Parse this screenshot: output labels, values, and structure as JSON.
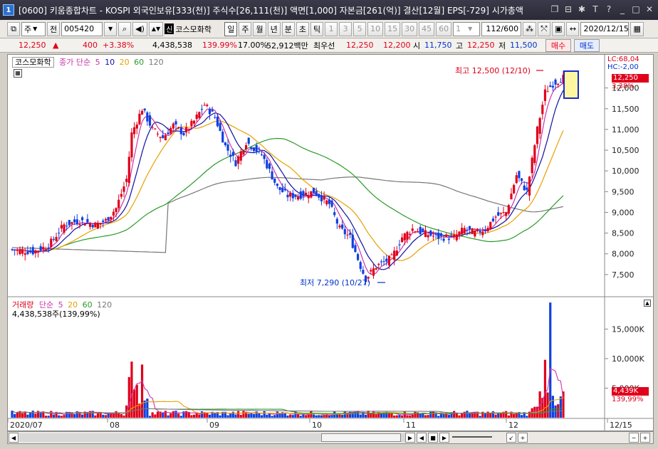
{
  "window": {
    "icon_label": "1",
    "title": "[0600] 키움종합차트 - KOSPI 외국인보유[333(천)] 주식수[26,111(천)] 액면[1,000] 자본금[261(억)] 결산[12월] EPS[-729] 시가총액"
  },
  "toolbar": {
    "type_select": "주",
    "jeon_btn": "전",
    "code": "005420",
    "company_badge": "신",
    "company": "코스모화학",
    "periods": [
      "일",
      "주",
      "월",
      "년",
      "분",
      "초",
      "틱"
    ],
    "active_period": "일",
    "intervals": [
      "1",
      "3",
      "5",
      "10",
      "15",
      "30",
      "45",
      "60"
    ],
    "interval_value": "1",
    "count": "112/600",
    "date": "2020/12/15"
  },
  "quote": {
    "price": "12,250",
    "arrow": "▲",
    "change": "400",
    "change_pct": "+3.38%",
    "volume": "4,438,538",
    "vol_ratio": "139.99%",
    "turnover": "17.00%",
    "amount": "52,912백만",
    "best_ask_label": "최우선",
    "best_ask": "12,250",
    "best_bid": "12,200",
    "open_label": "시",
    "open": "11,750",
    "high_label": "고",
    "high": "12,250",
    "low_label": "저",
    "low": "11,500",
    "buy_label": "매수",
    "sell_label": "매도"
  },
  "price_legend": {
    "name": "코스모화학",
    "ma_label": "종가 단순",
    "ma": [
      "5",
      "10",
      "20",
      "60",
      "120"
    ]
  },
  "volume_legend": {
    "label": "거래량",
    "ma_label": "단순",
    "ma": [
      "5",
      "20",
      "60",
      "120"
    ],
    "value": "4,438,538주(139,99%)"
  },
  "annotations": {
    "high": "최고 12,500 (12/10)",
    "low": "최저 7,290 (10/27)",
    "lc": "LC:68,04",
    "hc": "HC:-2,00",
    "cur_price": "12,250",
    "cur_pct": "3,38%",
    "vol_tag": "4,439K",
    "vol_pct": "139,99%"
  },
  "chart_data": {
    "type": "candlestick",
    "price_axis": [
      "12,000",
      "11,500",
      "11,000",
      "10,500",
      "10,000",
      "9,500",
      "9,000",
      "8,500",
      "8,000",
      "7,500"
    ],
    "volume_axis": [
      "15,000K",
      "10,000K",
      "5,000K"
    ],
    "x_labels": [
      "2020/07",
      "08",
      "09",
      "10",
      "11",
      "12",
      "12/15"
    ],
    "colors": {
      "up": "#e0001a",
      "down": "#1040e0",
      "ma5": "#cc33aa",
      "ma10": "#1010a0",
      "ma20": "#e8a000",
      "ma60": "#2a9a2a",
      "ma120": "#777777"
    }
  },
  "scroll": {
    "left_arrow": "◀",
    "right_arrow": "▶",
    "ctrl_icons": [
      "◀",
      "■",
      "▶"
    ],
    "end_icons": [
      "↙",
      "+",
      "−",
      "+"
    ]
  }
}
